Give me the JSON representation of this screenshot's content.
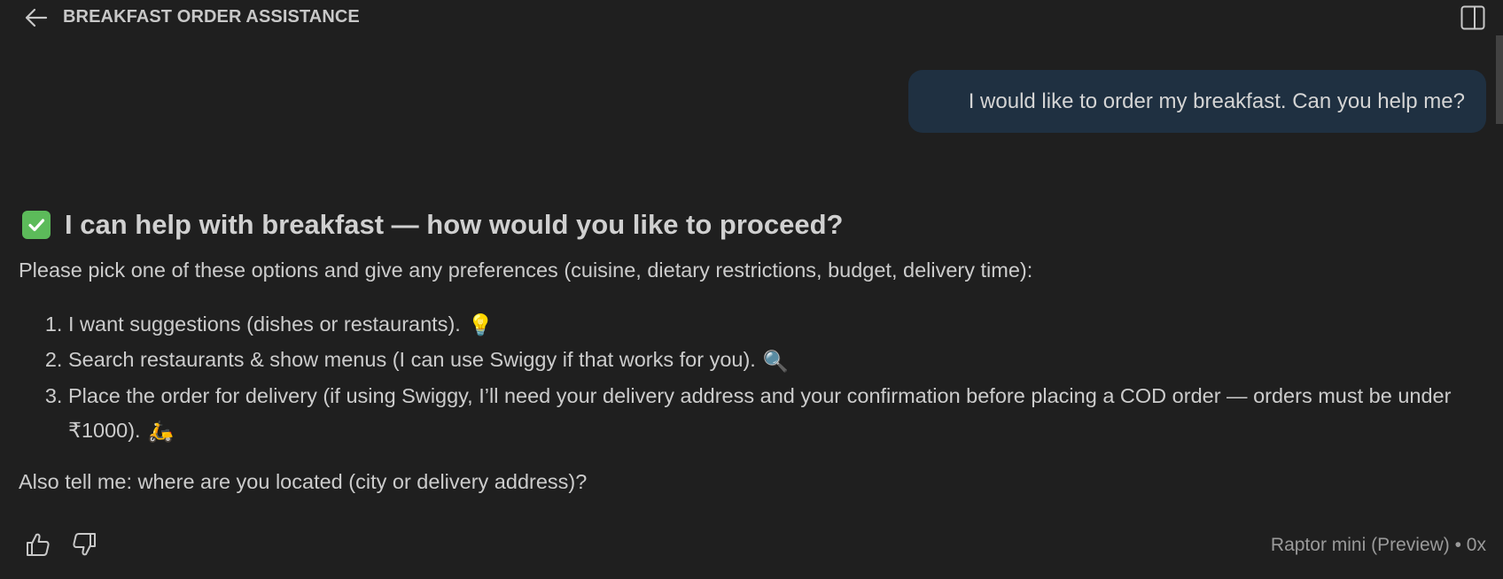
{
  "header": {
    "title": "BREAKFAST ORDER ASSISTANCE",
    "back_icon": "arrow-left-icon",
    "panel_icon": "split-panel-icon"
  },
  "chat": {
    "user_message": "I would like to order my breakfast. Can you help me?",
    "response": {
      "heading_emoji": "white-check-mark",
      "heading": "I can help with breakfast — how would you like to proceed?",
      "intro": "Please pick one of these options and give any preferences (cuisine, dietary restrictions, budget, delivery time):",
      "options": [
        {
          "text": "I want suggestions (dishes or restaurants).",
          "emoji": "💡"
        },
        {
          "text": "Search restaurants & show menus (I can use Swiggy if that works for you).",
          "emoji": "🔍"
        },
        {
          "text": "Place the order for delivery (if using Swiggy, I’ll need your delivery address and your confirmation before placing a COD order — orders must be under ₹1000).",
          "emoji": "🛵"
        }
      ],
      "location_question": "Also tell me: where are you located (city or delivery address)?"
    }
  },
  "footer": {
    "model_info": "Raptor mini (Preview) • 0x"
  },
  "colors": {
    "background": "#1f1f1f",
    "user_bubble": "#1f3041",
    "check": "#5cbb5a",
    "muted_text": "#9a9a9a"
  }
}
